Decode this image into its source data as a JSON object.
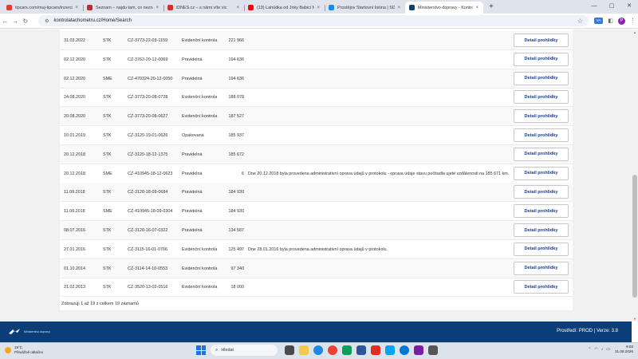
{
  "browser": {
    "tabs": [
      {
        "title": "tipcars.com/muj-tipcars/inzerce",
        "color": "#e53935",
        "active": false
      },
      {
        "title": "Seznam – najdu tam, co neznám",
        "color": "#c62828",
        "active": false
      },
      {
        "title": "iDNES.cz – s námi víte víc",
        "color": "#d32f2f",
        "active": false
      },
      {
        "title": "(19) Lahůdka od Jirky Babici No…",
        "color": "#ff0000",
        "active": false
      },
      {
        "title": "Prostějov Startovní listina | SDH…",
        "color": "#1e88e5",
        "active": false
      },
      {
        "title": "Ministerstvo dopravy - Kontrola…",
        "color": "#0b3e78",
        "active": true
      }
    ],
    "new_tab": "+",
    "url": "kontrolatachometru.cz/Home/Search",
    "extension_label": "VA",
    "profile_initial": "P"
  },
  "table": {
    "button_label": "Detail prohlídky",
    "rows": [
      {
        "date": "31.03.2022",
        "type": "STK",
        "protocol": "CZ-3773-22-03-1159",
        "kind": "Evidenční kontrola",
        "km": "221 966",
        "note": ""
      },
      {
        "date": "02.12.2020",
        "type": "STK",
        "protocol": "CZ-3762-20-12-0069",
        "kind": "Pravidelná",
        "km": "194 636",
        "note": ""
      },
      {
        "date": "02.12.2020",
        "type": "SME",
        "protocol": "CZ-470324-20-12-0050",
        "kind": "Pravidelná",
        "km": "194 636",
        "note": ""
      },
      {
        "date": "24.08.2020",
        "type": "STK",
        "protocol": "CZ-3773-20-08-0728",
        "kind": "Evidenční kontrola",
        "km": "188 078",
        "note": ""
      },
      {
        "date": "20.08.2020",
        "type": "STK",
        "protocol": "CZ-3773-20-08-0627",
        "kind": "Evidenční kontrola",
        "km": "187 527",
        "note": ""
      },
      {
        "date": "10.01.2019",
        "type": "STK",
        "protocol": "CZ-3120-19-01-0626",
        "kind": "Opakovaná",
        "km": "185 937",
        "note": ""
      },
      {
        "date": "20.12.2018",
        "type": "STK",
        "protocol": "CZ-3120-18-12-1375",
        "kind": "Pravidelná",
        "km": "185 672",
        "note": ""
      },
      {
        "date": "20.12.2018",
        "type": "SME",
        "protocol": "CZ-410945-18-12-0623",
        "kind": "Pravidelná",
        "km": "6",
        "note": "Dne 20.12.2018 byla provedena administrativní oprava údajů v protokolu - oprava údaje stavu počitadla ujeté vzdálenosti na 185 671 km."
      },
      {
        "date": "11.09.2018",
        "type": "STK",
        "protocol": "CZ-3120-18-09-0684",
        "kind": "Pravidelná",
        "km": "184 930",
        "note": ""
      },
      {
        "date": "11.09.2018",
        "type": "SME",
        "protocol": "CZ-410945-18-09-0304",
        "kind": "Pravidelná",
        "km": "184 930",
        "note": ""
      },
      {
        "date": "08.07.2016",
        "type": "STK",
        "protocol": "CZ-3120-16-07-0322",
        "kind": "Pravidelná",
        "km": "134 587",
        "note": ""
      },
      {
        "date": "27.01.2016",
        "type": "STK",
        "protocol": "CZ-3115-16-01-0766",
        "kind": "Evidenční kontrola",
        "km": "125 497",
        "note": "Dne 28.01.2016 byla provedena administrativní oprava údajů v protokolu."
      },
      {
        "date": "01.10.2014",
        "type": "STK",
        "protocol": "CZ-3114-14-10-0553",
        "kind": "Evidenční kontrola",
        "km": "97 340",
        "note": ""
      },
      {
        "date": "21.02.2013",
        "type": "STK",
        "protocol": "CZ-3520-13-02-0516",
        "kind": "Evidenční kontrola",
        "km": "18 000",
        "note": ""
      }
    ],
    "summary": "Zobrazuji 1 až 19 z celkem 19 záznamů"
  },
  "footer": {
    "logo_text": "Ministerstvo dopravy",
    "environment": "Prostředí: PROD | Verze: 3.8"
  },
  "taskbar": {
    "weather_temp": "19°C",
    "weather_text": "Převážně oblačno",
    "search_placeholder": "Hledat",
    "time": "9:03",
    "date": "31.08.2026"
  }
}
